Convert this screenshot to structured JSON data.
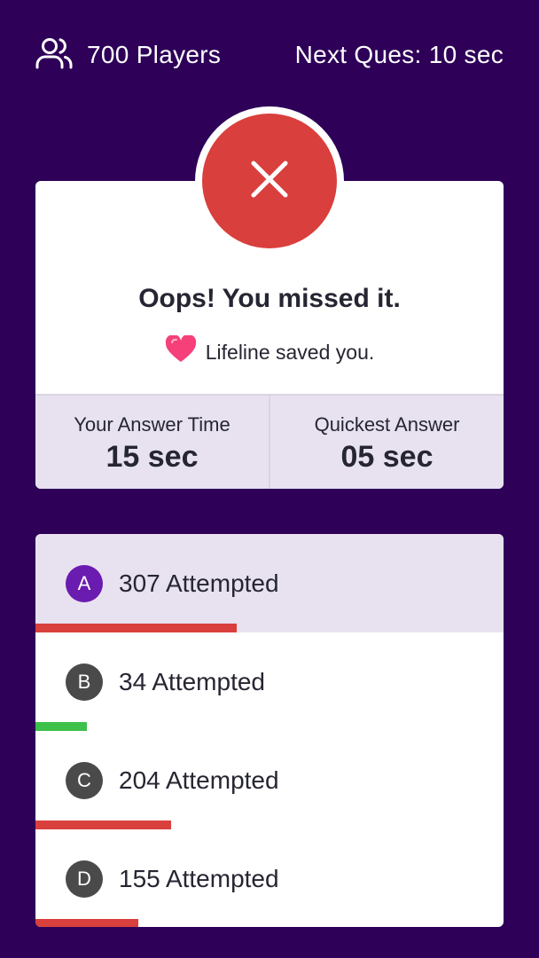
{
  "header": {
    "players_icon": "users-icon",
    "players_text": "700 Players",
    "next_question_text": "Next Ques: 10 sec"
  },
  "result": {
    "status_icon": "close-icon",
    "status_color": "#d93f3c",
    "title": "Oops! You missed it.",
    "lifeline_icon": "heart-icon",
    "lifeline_text": "Lifeline saved you.",
    "stats": [
      {
        "label": "Your Answer Time",
        "value": "15 sec"
      },
      {
        "label": "Quickest Answer",
        "value": "05 sec"
      }
    ]
  },
  "options": [
    {
      "letter": "A",
      "text": "307 Attempted",
      "share": 0.43,
      "bar_color": "#d93f3c",
      "letter_color": "#6a1bb0",
      "selected": true
    },
    {
      "letter": "B",
      "text": "34 Attempted",
      "share": 0.11,
      "bar_color": "#3cc04a",
      "letter_color": "#4a4a4a",
      "selected": false
    },
    {
      "letter": "C",
      "text": "204 Attempted",
      "share": 0.29,
      "bar_color": "#d93f3c",
      "letter_color": "#4a4a4a",
      "selected": false
    },
    {
      "letter": "D",
      "text": "155 Attempted",
      "share": 0.22,
      "bar_color": "#d93f3c",
      "letter_color": "#4a4a4a",
      "selected": false
    }
  ],
  "colors": {
    "background": "#2e0058",
    "card": "#ffffff",
    "highlight": "#e8e2f0"
  }
}
